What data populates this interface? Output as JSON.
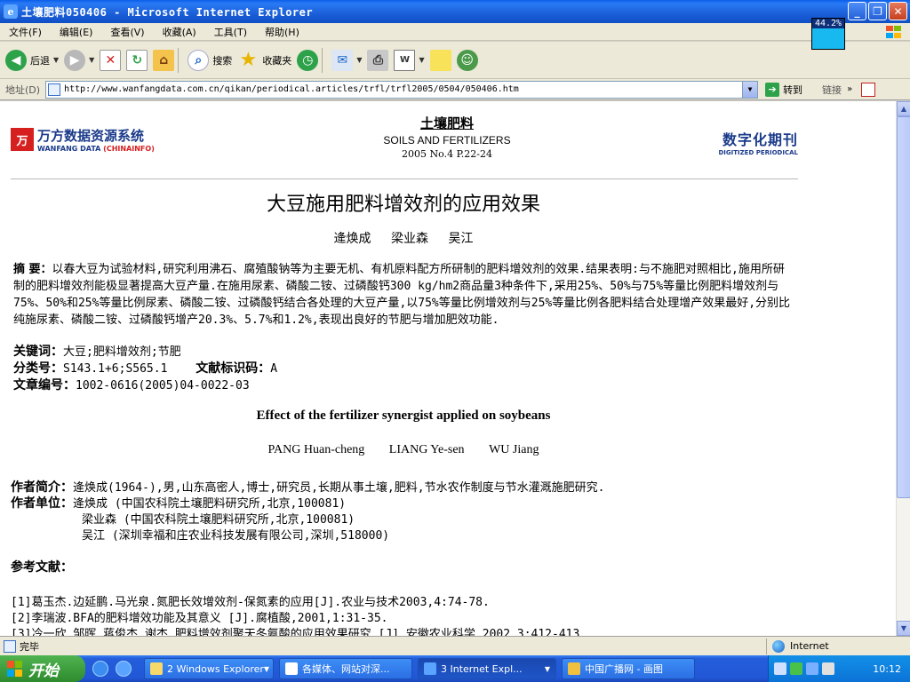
{
  "window": {
    "title": "土壤肥料050406 - Microsoft Internet Explorer",
    "zoom_badge": "44.2%"
  },
  "menu": [
    "文件(F)",
    "编辑(E)",
    "查看(V)",
    "收藏(A)",
    "工具(T)",
    "帮助(H)"
  ],
  "toolbar": {
    "back_label": "后退",
    "search_label": "搜索",
    "favorites_label": "收藏夹"
  },
  "address": {
    "label": "地址(D)",
    "url": "http://www.wanfangdata.com.cn/qikan/periodical.articles/trfl/trfl2005/0504/050406.htm",
    "go_label": "转到",
    "links_label": "链接"
  },
  "header": {
    "wanfang_cn": "万方数据资源系统",
    "wanfang_en_left": "WANFANG DATA",
    "wanfang_en_right": "(CHINAINFO)",
    "journal_cn": "土壤肥料",
    "journal_en": "SOILS AND FERTILIZERS",
    "issue": "2005 No.4 P.22-24",
    "digital_cn": "数字化期刊",
    "digital_en": "DIGITIZED PERIODICAL"
  },
  "article": {
    "title": "大豆施用肥料增效剂的应用效果",
    "authors_cn": "逄焕成 梁业森 吴江",
    "abstract_label": "摘 要：",
    "abstract_text": "以春大豆为试验材料,研究利用沸石、腐殖酸钠等为主要无机、有机原料配方所研制的肥料增效剂的效果.结果表明:与不施肥对照相比,施用所研制的肥料增效剂能极显著提高大豆产量.在施用尿素、磷酸二铵、过磷酸钙300 kg/hm2商品量3种条件下,采用25%、50%与75%等量比例肥料增效剂与75%、50%和25%等量比例尿素、磷酸二铵、过磷酸钙结合各处理的大豆产量,以75%等量比例增效剂与25%等量比例各肥料结合处理增产效果最好,分别比纯施尿素、磷酸二铵、过磷酸钙增产20.3%、5.7%和1.2%,表现出良好的节肥与增加肥效功能.",
    "keywords_label": "关键词：",
    "keywords": "大豆;肥料增效剂;节肥",
    "class_label": "分类号：",
    "class_value": "S143.1+6;S565.1",
    "doc_code_label": "文献标识码：",
    "doc_code_value": "A",
    "article_no_label": "文章编号：",
    "article_no_value": "1002-0616(2005)04-0022-03",
    "en_title": "Effect of the fertilizer synergist applied on soybeans",
    "en_authors": [
      "PANG Huan-cheng",
      "LIANG Ye-sen",
      "WU Jiang"
    ],
    "bio_label": "作者简介：",
    "bio_text": "逄焕成(1964-),男,山东高密人,博士,研究员,长期从事土壤,肥料,节水农作制度与节水灌溉施肥研究.",
    "affil_label": "作者单位：",
    "affiliations": [
      "逄焕成 (中国农科院土壤肥料研究所,北京,100081)",
      "梁业森 (中国农科院土壤肥料研究所,北京,100081)",
      "吴江 (深圳幸福和庄农业科技发展有限公司,深圳,518000)"
    ],
    "refs_heading": "参考文献：",
    "refs": [
      "[1]葛玉杰.边延鹏.马光泉.氮肥长效增效剂-保氮素的应用[J].农业与技术2003,4:74-78.",
      "[2]李瑞波.BFA的肥料增效功能及其意义 [J].腐植酸,2001,1:31-35.",
      "[3]冷一欣.邹晖.蒋俊杰.谢杰.肥料增效剂聚天冬氨酸的应用效果研究 [J].安徽农业科学,2002,3:412-413"
    ]
  },
  "status": {
    "text": "完毕",
    "zone": "Internet"
  },
  "taskbar": {
    "start_label": "开始",
    "tasks": [
      "2 Windows Explorer",
      "各媒体、网站对深...",
      "3 Internet Expl...",
      "中国广播网 - 画图"
    ],
    "clock": "10:12"
  }
}
